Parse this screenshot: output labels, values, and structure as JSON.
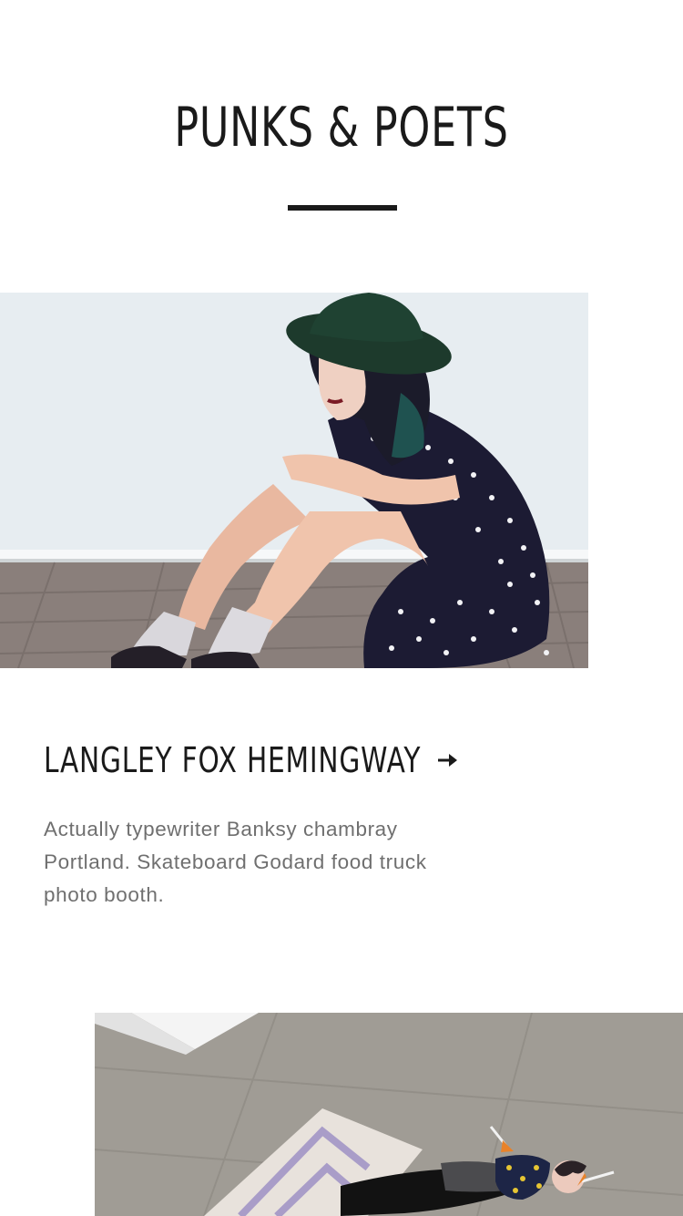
{
  "header": {
    "title": "PUNKS & POETS"
  },
  "feature": {
    "image_alt": "photo-model-seated-hat",
    "title": "LANGLEY FOX HEMINGWAY",
    "arrow_icon": "arrow-right-icon",
    "description": "Actually typewriter Banksy chambray Portland. Skateboard Godard food truck photo booth."
  },
  "next_feature": {
    "image_alt": "photo-model-lying-floor"
  },
  "colors": {
    "text": "#1a1a1a",
    "muted": "#6f6f6f",
    "background": "#ffffff"
  }
}
